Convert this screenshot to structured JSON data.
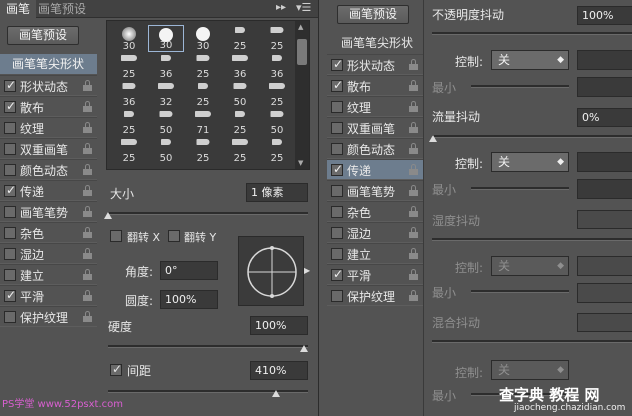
{
  "left": {
    "tabs": [
      "画笔",
      "画笔预设"
    ],
    "preset_button": "画笔预设",
    "list_header": "画笔笔尖形状",
    "list": [
      {
        "label": "形状动态",
        "checked": true
      },
      {
        "label": "散布",
        "checked": true
      },
      {
        "label": "纹理",
        "checked": false
      },
      {
        "label": "双重画笔",
        "checked": false
      },
      {
        "label": "颜色动态",
        "checked": false
      },
      {
        "label": "传递",
        "checked": true
      },
      {
        "label": "画笔笔势",
        "checked": false
      },
      {
        "label": "杂色",
        "checked": false
      },
      {
        "label": "湿边",
        "checked": false
      },
      {
        "label": "建立",
        "checked": false
      },
      {
        "label": "平滑",
        "checked": true
      },
      {
        "label": "保护纹理",
        "checked": false
      }
    ],
    "brush_sizes": [
      "30",
      "30",
      "30",
      "25",
      "25",
      "25",
      "36",
      "25",
      "36",
      "36",
      "36",
      "32",
      "25",
      "50",
      "25",
      "25",
      "50",
      "71",
      "25",
      "50",
      "25",
      "50",
      "25",
      "25",
      "25"
    ],
    "size_label": "大小",
    "size_value": "1 像素",
    "flip_x": "翻转 X",
    "flip_y": "翻转 Y",
    "angle_label": "角度:",
    "angle_value": "0°",
    "roundness_label": "圆度:",
    "roundness_value": "100%",
    "hardness_label": "硬度",
    "hardness_value": "100%",
    "spacing_label": "间距",
    "spacing_value": "410%",
    "watermark": "PS学堂 www.52psxt.com"
  },
  "right": {
    "preset_button": "画笔预设",
    "list_header": "画笔笔尖形状",
    "list": [
      {
        "label": "形状动态",
        "checked": true,
        "selected": false
      },
      {
        "label": "散布",
        "checked": true,
        "selected": false
      },
      {
        "label": "纹理",
        "checked": false,
        "selected": false
      },
      {
        "label": "双重画笔",
        "checked": false,
        "selected": false
      },
      {
        "label": "颜色动态",
        "checked": false,
        "selected": false
      },
      {
        "label": "传递",
        "checked": true,
        "selected": true
      },
      {
        "label": "画笔笔势",
        "checked": false,
        "selected": false
      },
      {
        "label": "杂色",
        "checked": false,
        "selected": false
      },
      {
        "label": "湿边",
        "checked": false,
        "selected": false
      },
      {
        "label": "建立",
        "checked": false,
        "selected": false
      },
      {
        "label": "平滑",
        "checked": true,
        "selected": false
      },
      {
        "label": "保护纹理",
        "checked": false,
        "selected": false
      }
    ],
    "opacity_jitter_label": "不透明度抖动",
    "opacity_jitter_value": "100%",
    "control_label": "控制:",
    "control_off": "关",
    "min_label": "最小",
    "flow_jitter_label": "流量抖动",
    "flow_jitter_value": "0%",
    "wetness_jitter_label": "湿度抖动",
    "mix_jitter_label": "混合抖动",
    "watermark": "查字典 教程 网",
    "watermark_url": "jiaocheng.chazidian.com"
  }
}
